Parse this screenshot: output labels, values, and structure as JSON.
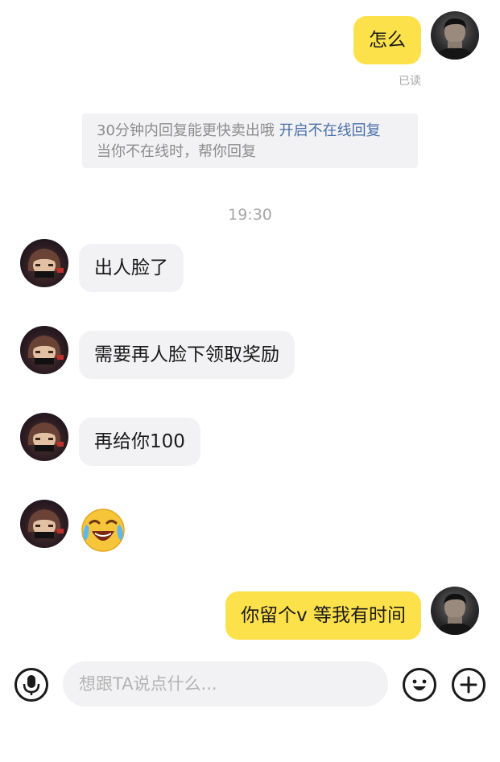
{
  "messages": {
    "m1": {
      "text": "怎么",
      "read_status": "已读"
    },
    "system_notice": {
      "line1": "30分钟内回复能更快卖出哦",
      "link": "开启不在线回复",
      "line2": "当你不在线时，帮你回复"
    },
    "timestamp": "19:30",
    "m2": {
      "text": "出人脸了"
    },
    "m3": {
      "text": "需要再人脸下领取奖励"
    },
    "m4": {
      "text": "再给你100"
    },
    "m5": {
      "emoji": "crying-laughing-emoji"
    },
    "m6": {
      "text": "你留个v 等我有时间"
    }
  },
  "input_bar": {
    "placeholder": "想跟TA说点什么...",
    "value": "",
    "voice_icon": "microphone-icon",
    "emoji_icon": "smiley-icon",
    "plus_icon": "plus-icon"
  },
  "colors": {
    "my_bubble": "#fde14b",
    "their_bubble": "#f2f2f4",
    "link": "#4a6fa8",
    "muted_text": "#a6a6a6"
  }
}
